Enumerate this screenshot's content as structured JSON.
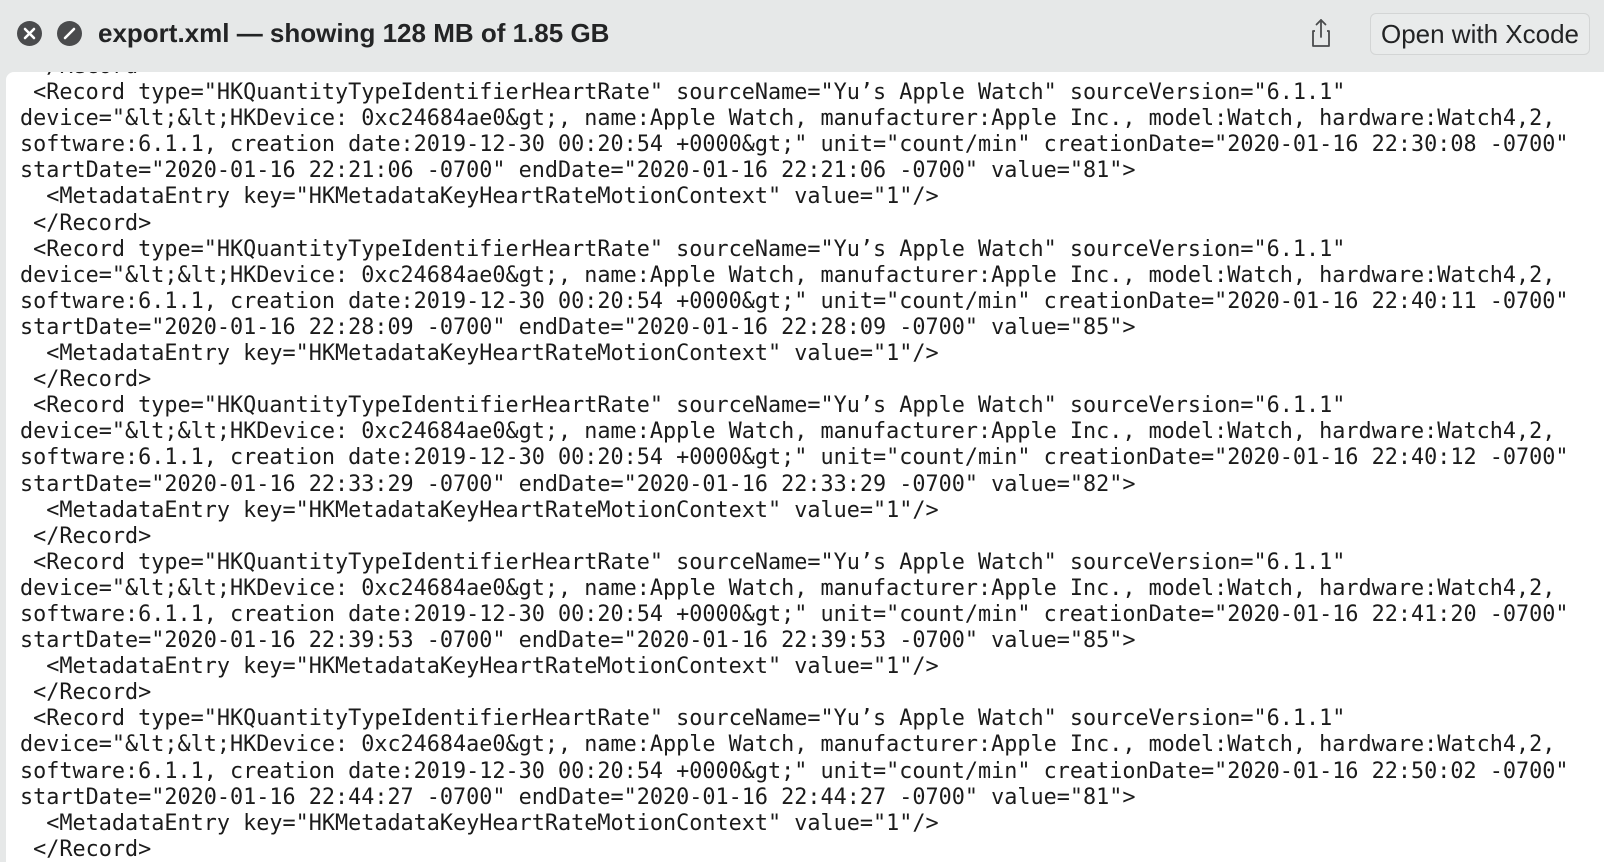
{
  "window": {
    "title": "export.xml — showing 128 MB of 1.85 GB",
    "open_with_label": "Open with Xcode",
    "icons": [
      "close-icon",
      "minimize-icon",
      "share-icon"
    ]
  },
  "colors": {
    "titlebar_bg": "#e6e8e8",
    "content_bg": "#ffffff",
    "text": "#1b1b1b",
    "traffic_light": "#4a4b4d"
  },
  "content": {
    "lines": [
      " </Record>",
      " <Record type=\"HKQuantityTypeIdentifierHeartRate\" sourceName=\"Yu’s Apple Watch\" sourceVersion=\"6.1.1\"",
      "device=\"&lt;&lt;HKDevice: 0xc24684ae0&gt;, name:Apple Watch, manufacturer:Apple Inc., model:Watch, hardware:Watch4,2,",
      "software:6.1.1, creation date:2019-12-30 00:20:54 +0000&gt;\" unit=\"count/min\" creationDate=\"2020-01-16 22:30:08 -0700\"",
      "startDate=\"2020-01-16 22:21:06 -0700\" endDate=\"2020-01-16 22:21:06 -0700\" value=\"81\">",
      "  <MetadataEntry key=\"HKMetadataKeyHeartRateMotionContext\" value=\"1\"/>",
      " </Record>",
      " <Record type=\"HKQuantityTypeIdentifierHeartRate\" sourceName=\"Yu’s Apple Watch\" sourceVersion=\"6.1.1\"",
      "device=\"&lt;&lt;HKDevice: 0xc24684ae0&gt;, name:Apple Watch, manufacturer:Apple Inc., model:Watch, hardware:Watch4,2,",
      "software:6.1.1, creation date:2019-12-30 00:20:54 +0000&gt;\" unit=\"count/min\" creationDate=\"2020-01-16 22:40:11 -0700\"",
      "startDate=\"2020-01-16 22:28:09 -0700\" endDate=\"2020-01-16 22:28:09 -0700\" value=\"85\">",
      "  <MetadataEntry key=\"HKMetadataKeyHeartRateMotionContext\" value=\"1\"/>",
      " </Record>",
      " <Record type=\"HKQuantityTypeIdentifierHeartRate\" sourceName=\"Yu’s Apple Watch\" sourceVersion=\"6.1.1\"",
      "device=\"&lt;&lt;HKDevice: 0xc24684ae0&gt;, name:Apple Watch, manufacturer:Apple Inc., model:Watch, hardware:Watch4,2,",
      "software:6.1.1, creation date:2019-12-30 00:20:54 +0000&gt;\" unit=\"count/min\" creationDate=\"2020-01-16 22:40:12 -0700\"",
      "startDate=\"2020-01-16 22:33:29 -0700\" endDate=\"2020-01-16 22:33:29 -0700\" value=\"82\">",
      "  <MetadataEntry key=\"HKMetadataKeyHeartRateMotionContext\" value=\"1\"/>",
      " </Record>",
      " <Record type=\"HKQuantityTypeIdentifierHeartRate\" sourceName=\"Yu’s Apple Watch\" sourceVersion=\"6.1.1\"",
      "device=\"&lt;&lt;HKDevice: 0xc24684ae0&gt;, name:Apple Watch, manufacturer:Apple Inc., model:Watch, hardware:Watch4,2,",
      "software:6.1.1, creation date:2019-12-30 00:20:54 +0000&gt;\" unit=\"count/min\" creationDate=\"2020-01-16 22:41:20 -0700\"",
      "startDate=\"2020-01-16 22:39:53 -0700\" endDate=\"2020-01-16 22:39:53 -0700\" value=\"85\">",
      "  <MetadataEntry key=\"HKMetadataKeyHeartRateMotionContext\" value=\"1\"/>",
      " </Record>",
      " <Record type=\"HKQuantityTypeIdentifierHeartRate\" sourceName=\"Yu’s Apple Watch\" sourceVersion=\"6.1.1\"",
      "device=\"&lt;&lt;HKDevice: 0xc24684ae0&gt;, name:Apple Watch, manufacturer:Apple Inc., model:Watch, hardware:Watch4,2,",
      "software:6.1.1, creation date:2019-12-30 00:20:54 +0000&gt;\" unit=\"count/min\" creationDate=\"2020-01-16 22:50:02 -0700\"",
      "startDate=\"2020-01-16 22:44:27 -0700\" endDate=\"2020-01-16 22:44:27 -0700\" value=\"81\">",
      "  <MetadataEntry key=\"HKMetadataKeyHeartRateMotionContext\" value=\"1\"/>",
      " </Record>"
    ]
  }
}
